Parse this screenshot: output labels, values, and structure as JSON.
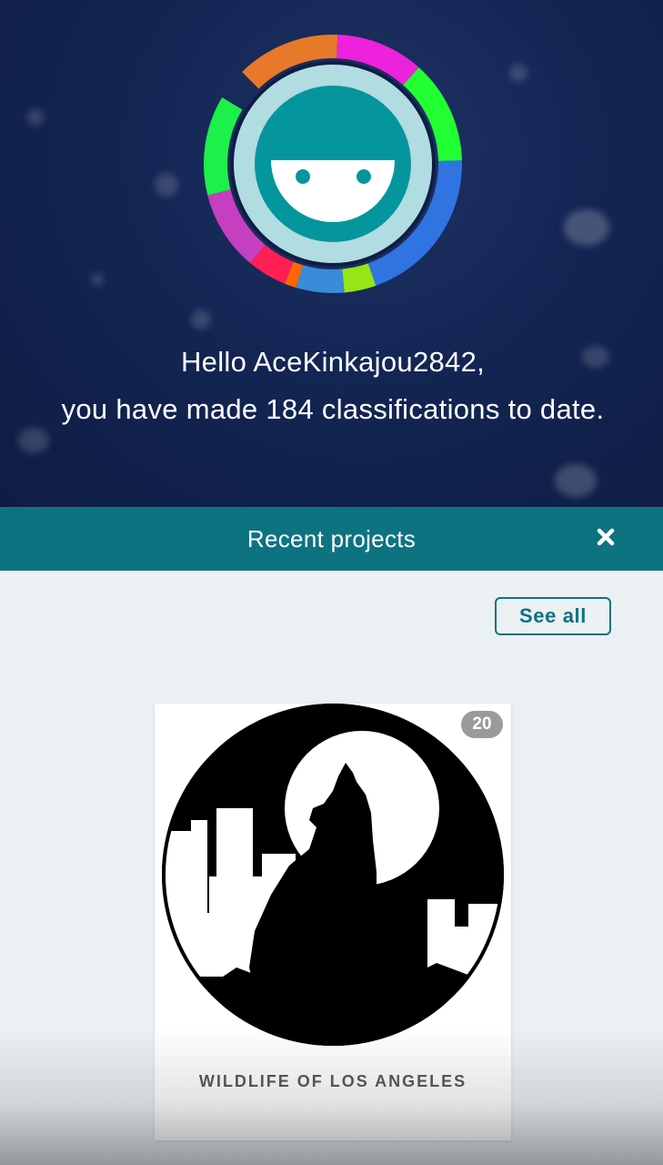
{
  "user": {
    "greeting_line1": "Hello AceKinkajou2842,",
    "greeting_line2": "you have made 184 classifications to date.",
    "avatar_icon": "zooniverse-smiley-avatar-icon",
    "classification_ring_colors": [
      "#e8792a",
      "#ee22dd",
      "#22ff33",
      "#2f74e0",
      "#96e615",
      "#3a8bd8",
      "#ff6600",
      "#ff1f55",
      "#c53fc0",
      "#1df04a"
    ]
  },
  "recent_projects": {
    "title": "Recent projects",
    "close_icon": "close-icon",
    "see_all_label": "See all",
    "projects": [
      {
        "name": "WILDLIFE OF LOS ANGELES",
        "count": "20",
        "image": "howling-coyote-city-moon-logo"
      }
    ]
  },
  "colors": {
    "accent": "#0d7380",
    "hero_bg": "#132553",
    "page_bg": "#ebf0f3"
  }
}
